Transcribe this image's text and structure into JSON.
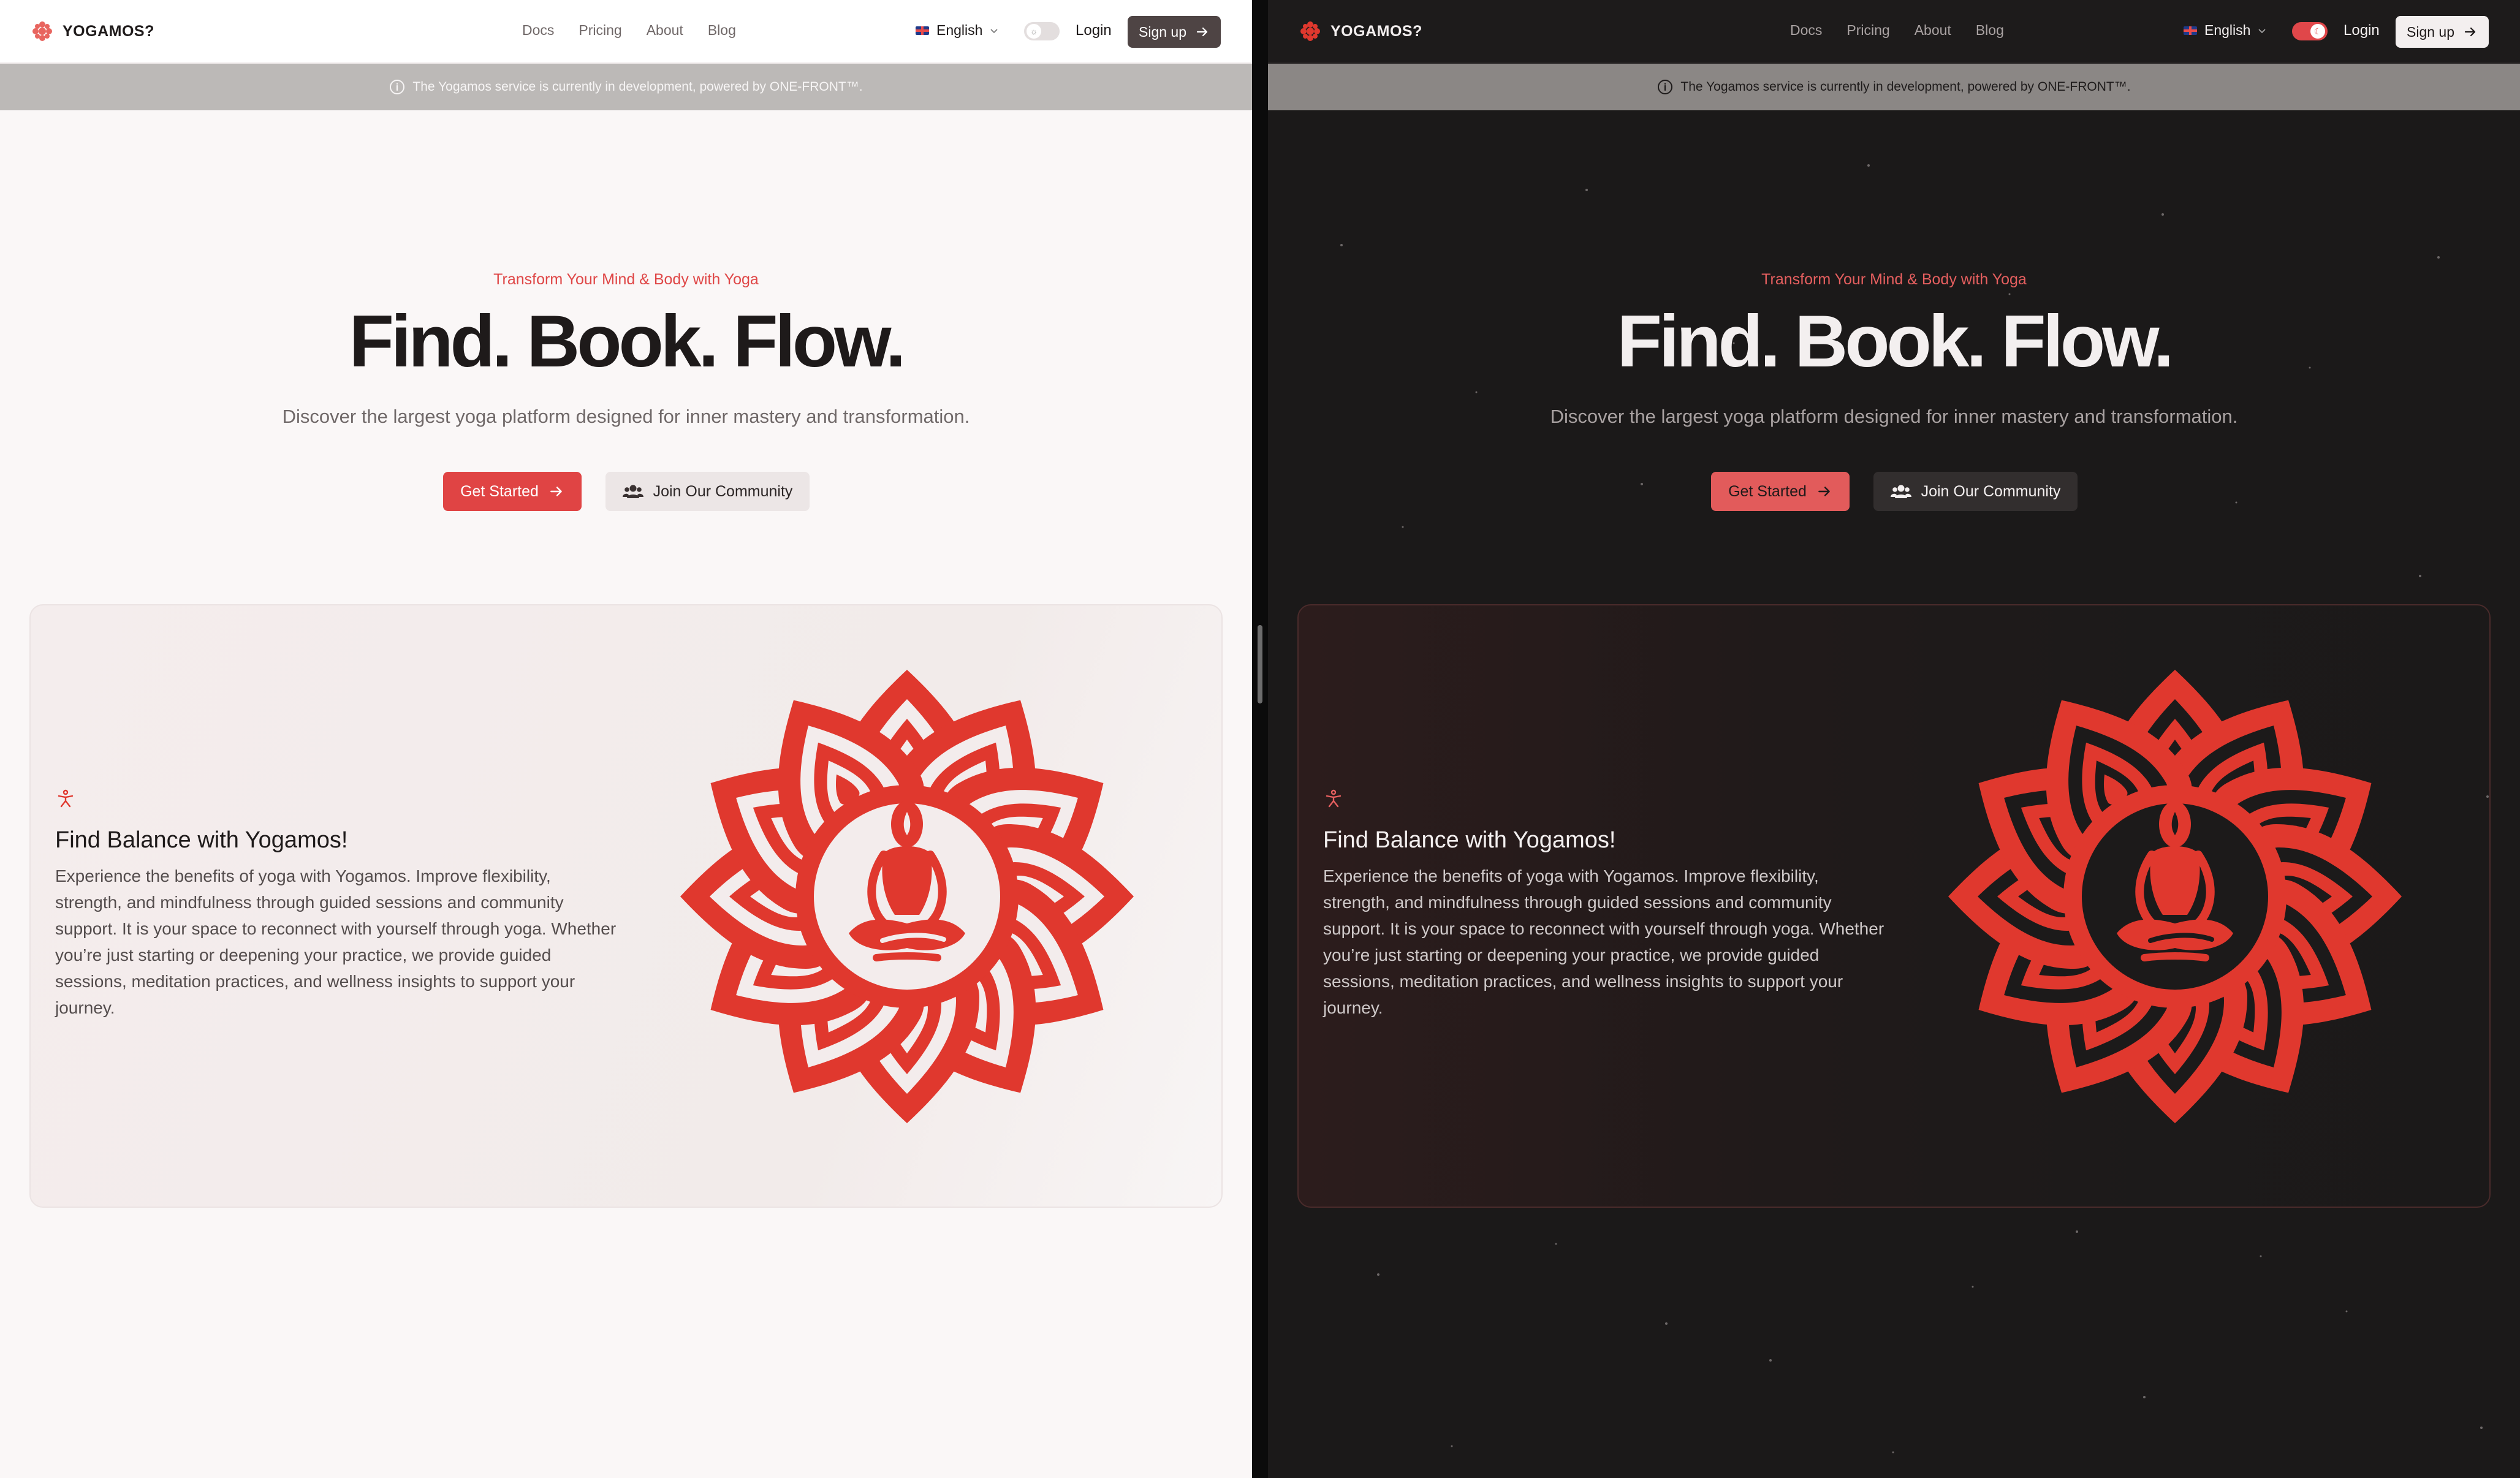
{
  "brand": {
    "name": "YOGAMOS?"
  },
  "nav": {
    "items": [
      "Docs",
      "Pricing",
      "About",
      "Blog"
    ]
  },
  "language": {
    "selected": "English"
  },
  "auth": {
    "login_label": "Login",
    "signup_label": "Sign up"
  },
  "notice": {
    "text": "The Yogamos service is currently in development, powered by ONE-FRONT™."
  },
  "hero": {
    "kicker": "Transform Your Mind & Body with Yoga",
    "title": "Find. Book. Flow.",
    "subtitle": "Discover the largest yoga platform designed for inner mastery and transformation.",
    "primary_cta": "Get Started",
    "secondary_cta": "Join Our Community"
  },
  "feature": {
    "title": "Find Balance with Yogamos!",
    "body": "Experience the benefits of yoga with Yogamos. Improve flexibility, strength, and mindfulness through guided sessions and community support. It is your space to reconnect with yourself through yoga. Whether you’re just starting or deepening your practice, we provide guided sessions, meditation practices, and wellness insights to support your journey."
  },
  "colors": {
    "accent": "#e0382e",
    "light_bg": "#faf7f7",
    "dark_bg": "#1b1919"
  },
  "icons": [
    "lotus-logo-icon",
    "info-icon",
    "flag-uk-icon",
    "chevron-down-icon",
    "theme-toggle-icon",
    "arrow-right-icon",
    "users-icon",
    "yoga-pose-icon",
    "lotus-meditation-illustration"
  ]
}
